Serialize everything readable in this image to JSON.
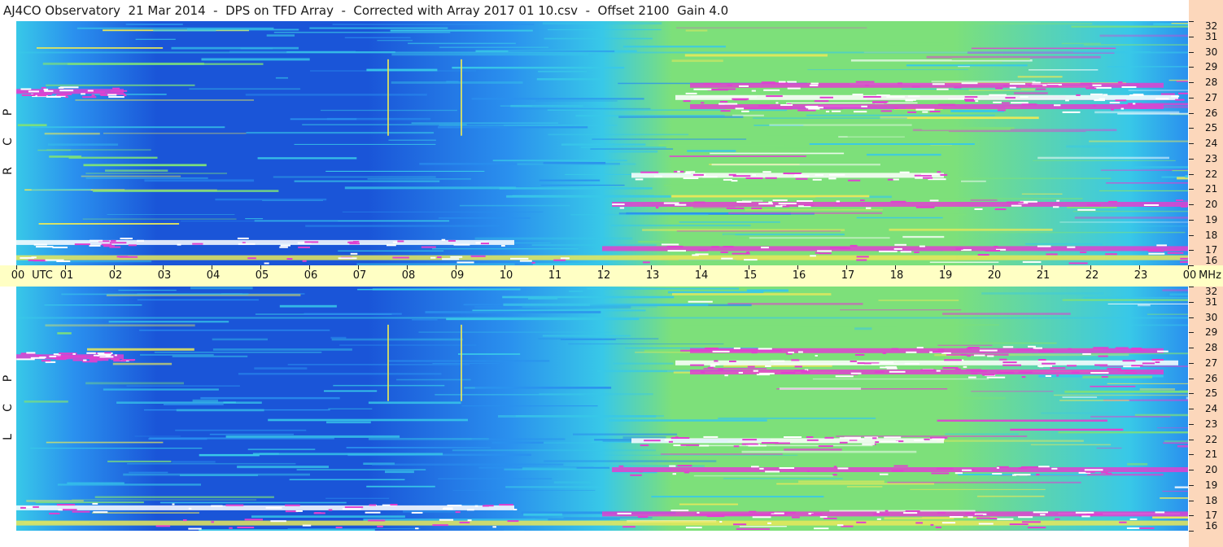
{
  "title": "AJ4CO Observatory  21 Mar 2014  -  DPS on TFD Array  -  Corrected with Array 2017 01 10.csv  -  Offset 2100  Gain 4.0",
  "panels": {
    "top_label": [
      "R",
      "C",
      "P"
    ],
    "bottom_label": [
      "L",
      "C",
      "P"
    ]
  },
  "colors": {
    "deep_blue": "#1a55d8",
    "mid_blue": "#2a90ee",
    "cyan": "#38c8e8",
    "green": "#7de07a",
    "yellow": "#e8e85a",
    "magenta": "#e040d0",
    "white": "#ffffff",
    "axis_band": "#ffffc4",
    "right_band": "#fcd7bb"
  },
  "chart_data": {
    "type": "heatmap",
    "title": "AJ4CO Observatory  21 Mar 2014  -  DPS on TFD Array  -  Corrected with Array 2017 01 10.csv  -  Offset 2100  Gain 4.0",
    "x_axis": {
      "label": "UTC",
      "ticks": [
        "00",
        "01",
        "02",
        "03",
        "04",
        "05",
        "06",
        "07",
        "08",
        "09",
        "10",
        "11",
        "12",
        "13",
        "14",
        "15",
        "16",
        "17",
        "18",
        "19",
        "20",
        "21",
        "22",
        "23",
        "00"
      ],
      "range": [
        0,
        24
      ]
    },
    "y_axis": {
      "label": "MHz",
      "ticks": [
        "16",
        "17",
        "18",
        "19",
        "20",
        "21",
        "22",
        "23",
        "24",
        "25",
        "26",
        "27",
        "28",
        "29",
        "30",
        "31",
        "32"
      ],
      "range": [
        16,
        32
      ]
    },
    "series": [
      {
        "name": "RCP"
      },
      {
        "name": "LCP"
      }
    ],
    "bands": [
      {
        "mhz": 27.0,
        "utc": [
          13.5,
          23.8
        ],
        "level": "white"
      },
      {
        "mhz": 27.8,
        "utc": [
          13.8,
          23.5
        ],
        "level": "magenta"
      },
      {
        "mhz": 26.4,
        "utc": [
          13.8,
          23.5
        ],
        "level": "magenta"
      },
      {
        "mhz": 27.4,
        "utc": [
          0.0,
          2.2
        ],
        "level": "magenta"
      },
      {
        "mhz": 21.9,
        "utc": [
          12.6,
          19.0
        ],
        "level": "white"
      },
      {
        "mhz": 17.5,
        "utc": [
          0.0,
          10.2
        ],
        "level": "white"
      },
      {
        "mhz": 17.1,
        "utc": [
          12.0,
          24.0
        ],
        "level": "magenta"
      },
      {
        "mhz": 20.0,
        "utc": [
          12.2,
          24.0
        ],
        "level": "magenta"
      },
      {
        "mhz": 16.5,
        "utc": [
          0.0,
          24.0
        ],
        "level": "yellow"
      }
    ],
    "spikes_utc": [
      7.6,
      9.1
    ]
  }
}
